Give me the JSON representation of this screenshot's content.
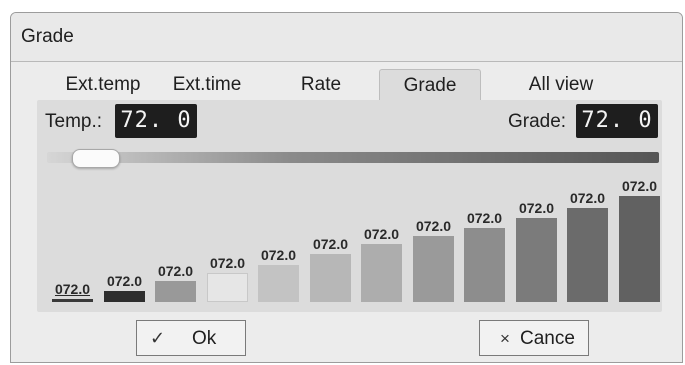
{
  "window": {
    "title": "Grade"
  },
  "tabs": [
    {
      "label": "Ext.temp",
      "active": false
    },
    {
      "label": "Ext.time",
      "active": false
    },
    {
      "label": "Rate",
      "active": false
    },
    {
      "label": "Grade",
      "active": true
    },
    {
      "label": "All view",
      "active": false
    }
  ],
  "temp": {
    "label": "Temp.:",
    "value": "72. 0"
  },
  "grade": {
    "label": "Grade:",
    "value": "72. 0"
  },
  "slider": {
    "level": 0.03
  },
  "bars": [
    {
      "label": "072.0",
      "level": 0.02,
      "color": "#3a3a3a"
    },
    {
      "label": "072.0",
      "level": 0.1,
      "color": "#2e2e2e"
    },
    {
      "label": "072.0",
      "level": 0.19,
      "color": "#999999"
    },
    {
      "label": "072.0",
      "level": 0.26,
      "color": "#e6e6e6"
    },
    {
      "label": "072.0",
      "level": 0.33,
      "color": "#c3c3c3"
    },
    {
      "label": "072.0",
      "level": 0.43,
      "color": "#b7b7b7"
    },
    {
      "label": "072.0",
      "level": 0.52,
      "color": "#adadad"
    },
    {
      "label": "072.0",
      "level": 0.59,
      "color": "#9a9a9a"
    },
    {
      "label": "072.0",
      "level": 0.66,
      "color": "#8d8d8d"
    },
    {
      "label": "072.0",
      "level": 0.75,
      "color": "#7b7b7b"
    },
    {
      "label": "072.0",
      "level": 0.84,
      "color": "#6b6b6b"
    },
    {
      "label": "072.0",
      "level": 0.95,
      "color": "#616161"
    }
  ],
  "buttons": {
    "ok": {
      "icon": "✓",
      "label": "Ok"
    },
    "cancel": {
      "icon": "×",
      "label": "Cance"
    }
  }
}
